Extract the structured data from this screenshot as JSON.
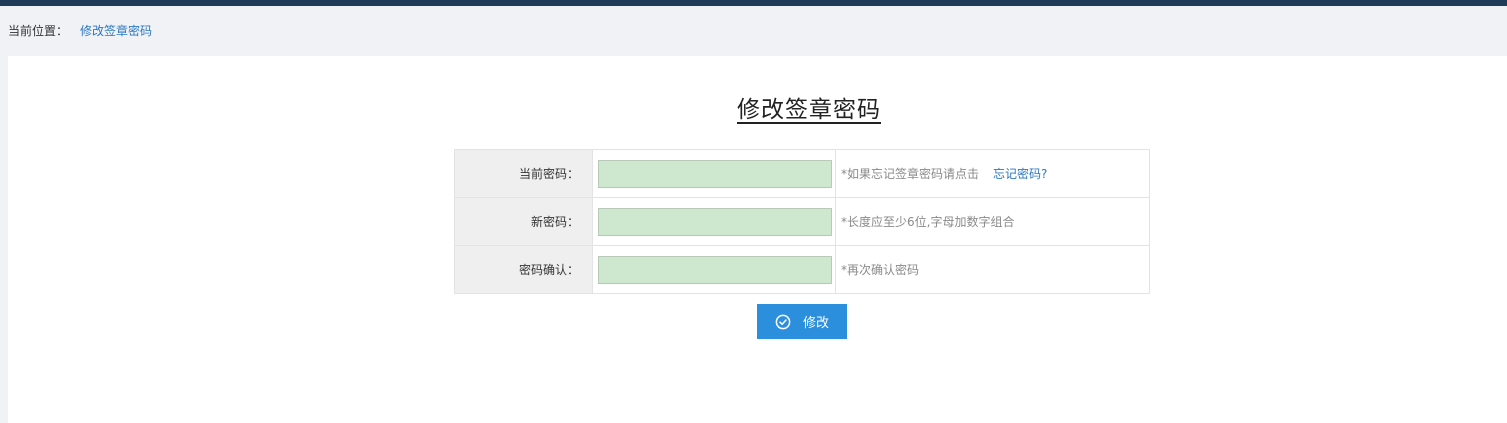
{
  "breadcrumb": {
    "prefix": "当前位置：",
    "current": "修改签章密码"
  },
  "page": {
    "title": "修改签章密码"
  },
  "form": {
    "rows": [
      {
        "label": "当前密码：",
        "value": "",
        "hint": "*如果忘记签章密码请点击",
        "link": "忘记密码?"
      },
      {
        "label": "新密码：",
        "value": "",
        "hint": "*长度应至少6位,字母加数字组合"
      },
      {
        "label": "密码确认：",
        "value": "",
        "hint": "*再次确认密码"
      }
    ],
    "submit_label": "修改"
  },
  "icons": {
    "submit": "check-circle-icon"
  },
  "colors": {
    "topbar": "#1f3b58",
    "link": "#2a78c2",
    "button": "#2b8fde",
    "input_bg": "#cde8cf",
    "label_bg": "#efefef"
  }
}
